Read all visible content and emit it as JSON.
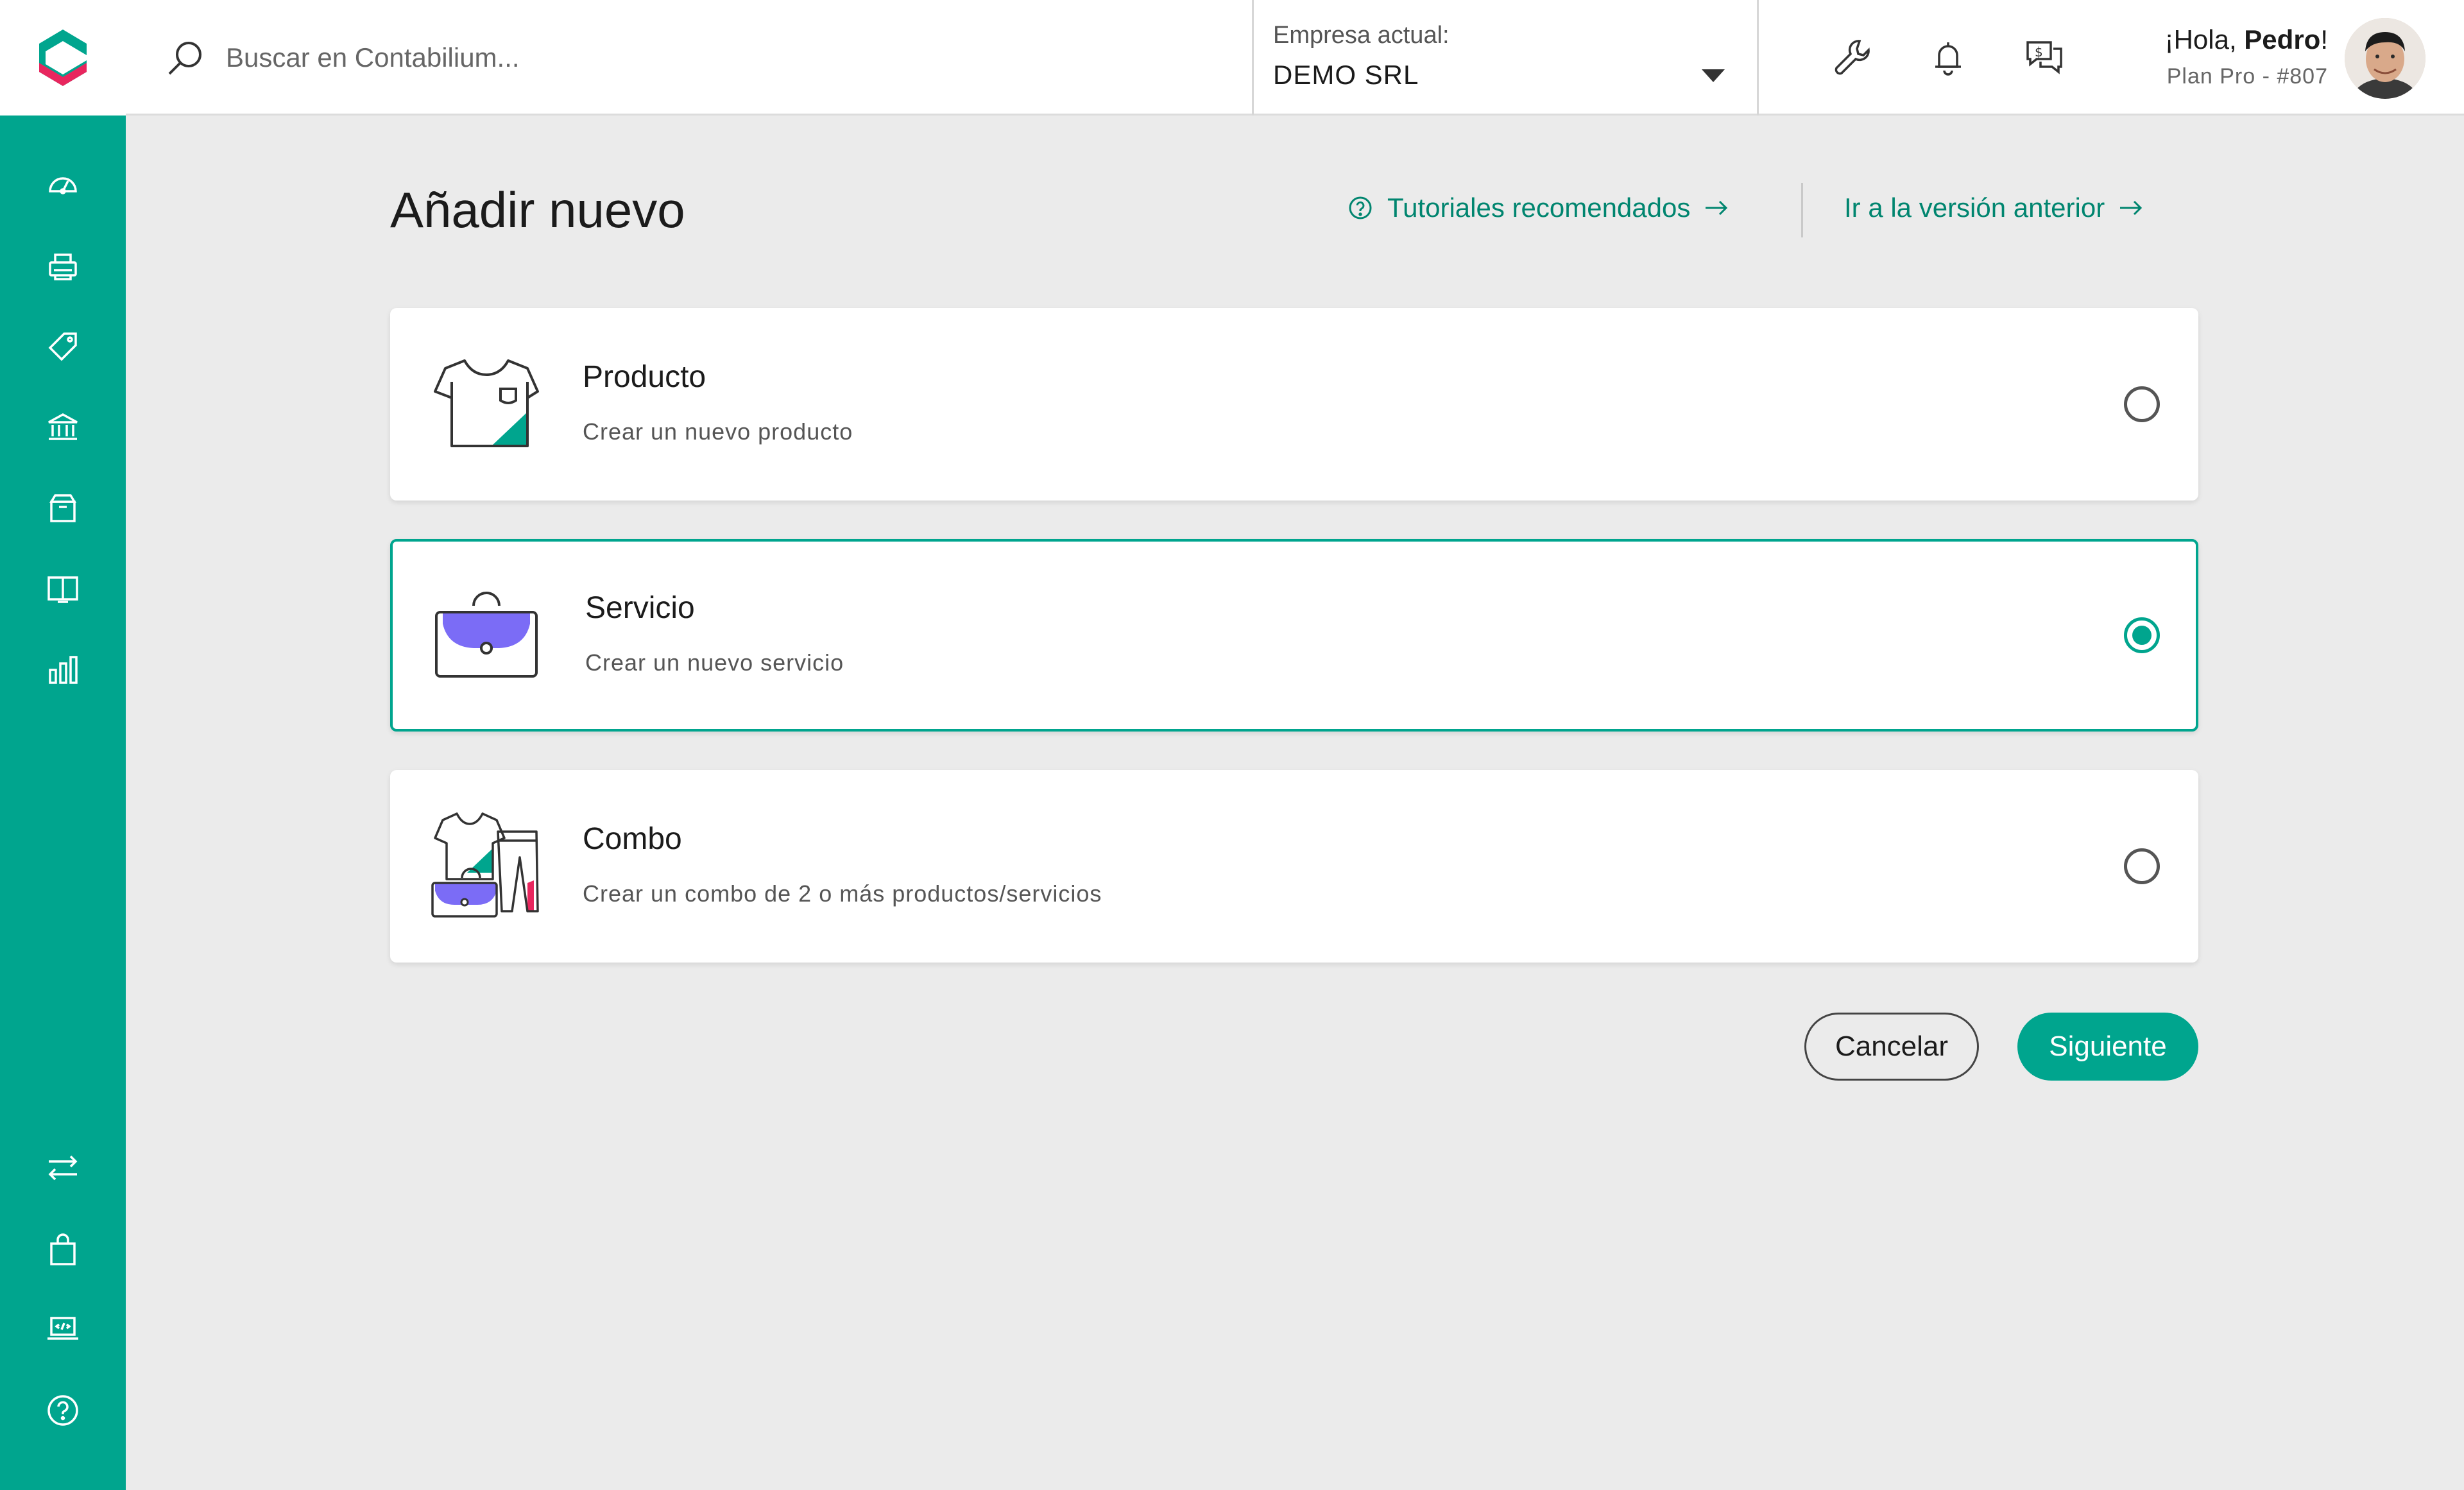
{
  "header": {
    "search_placeholder": "Buscar en Contabilium...",
    "company_label": "Empresa actual:",
    "company_value": "DEMO SRL",
    "greeting_prefix": "¡Hola, ",
    "greeting_name": "Pedro",
    "greeting_suffix": "!",
    "plan": "Plan Pro - #807"
  },
  "sidebar": {
    "top_icons": [
      "dashboard-icon",
      "printer-icon",
      "tag-icon",
      "bank-icon",
      "box-icon",
      "book-icon",
      "chart-icon"
    ],
    "bottom_icons": [
      "transfer-icon",
      "shopping-bag-icon",
      "code-laptop-icon",
      "help-icon"
    ]
  },
  "page": {
    "title": "Añadir nuevo",
    "link_tutorials": "Tutoriales recomendados",
    "link_previous": "Ir a la versión anterior"
  },
  "options": [
    {
      "name": "Producto",
      "desc": "Crear un nuevo producto",
      "selected": false
    },
    {
      "name": "Servicio",
      "desc": "Crear un nuevo servicio",
      "selected": true
    },
    {
      "name": "Combo",
      "desc": "Crear un combo de 2 o más productos/servicios",
      "selected": false
    }
  ],
  "buttons": {
    "cancel": "Cancelar",
    "next": "Siguiente"
  },
  "colors": {
    "accent": "#00a58e",
    "accent_dark": "#00856f",
    "purple": "#7b6cf6",
    "pink": "#e8265e"
  }
}
